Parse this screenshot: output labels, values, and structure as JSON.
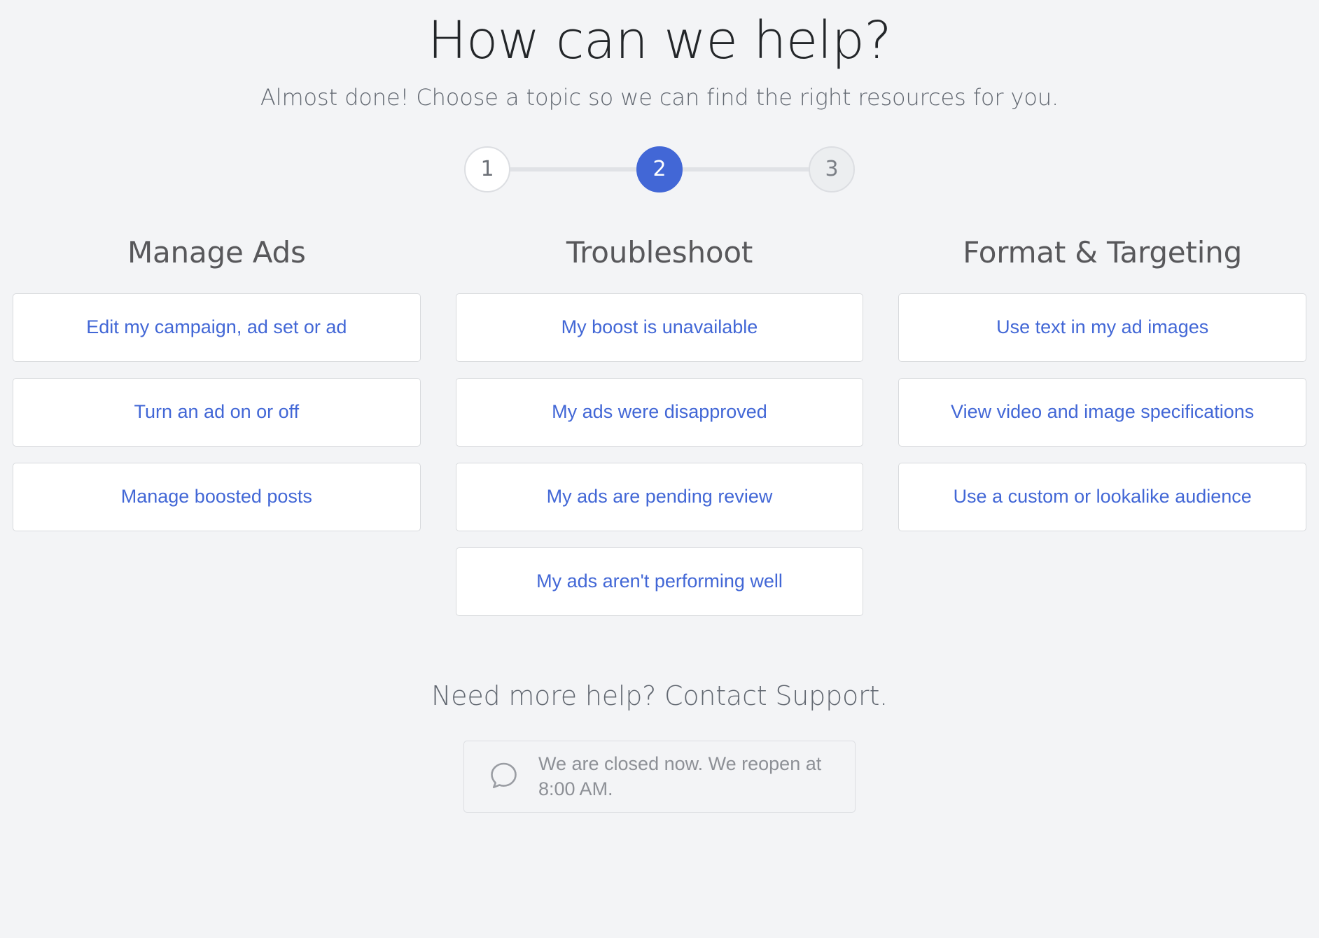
{
  "header": {
    "title": "How can we help?",
    "subtitle": "Almost done! Choose a topic so we can find the right resources for you."
  },
  "stepper": {
    "steps": [
      {
        "label": "1",
        "state": "done"
      },
      {
        "label": "2",
        "state": "active"
      },
      {
        "label": "3",
        "state": "todo"
      }
    ],
    "active_color": "#4267d6",
    "line_color": "#e0e2e6"
  },
  "columns": [
    {
      "title": "Manage Ads",
      "topics": [
        "Edit my campaign, ad set or ad",
        "Turn an ad on or off",
        "Manage boosted posts"
      ]
    },
    {
      "title": "Troubleshoot",
      "topics": [
        "My boost is unavailable",
        "My ads were disapproved",
        "My ads are pending review",
        "My ads aren't performing well"
      ]
    },
    {
      "title": "Format & Targeting",
      "topics": [
        "Use text in my ad images",
        "View video and image specifications",
        "Use a custom or lookalike audience"
      ]
    }
  ],
  "footer": {
    "contact_line": "Need more help? Contact Support.",
    "chat_status": {
      "icon": "chat-bubble-icon",
      "text": "We are closed now. We reopen at 8:00 AM."
    }
  },
  "theme": {
    "background": "#f3f4f6",
    "link_blue": "#4267d6",
    "heading_gray": "#58585b",
    "muted_gray": "#8d9096"
  }
}
